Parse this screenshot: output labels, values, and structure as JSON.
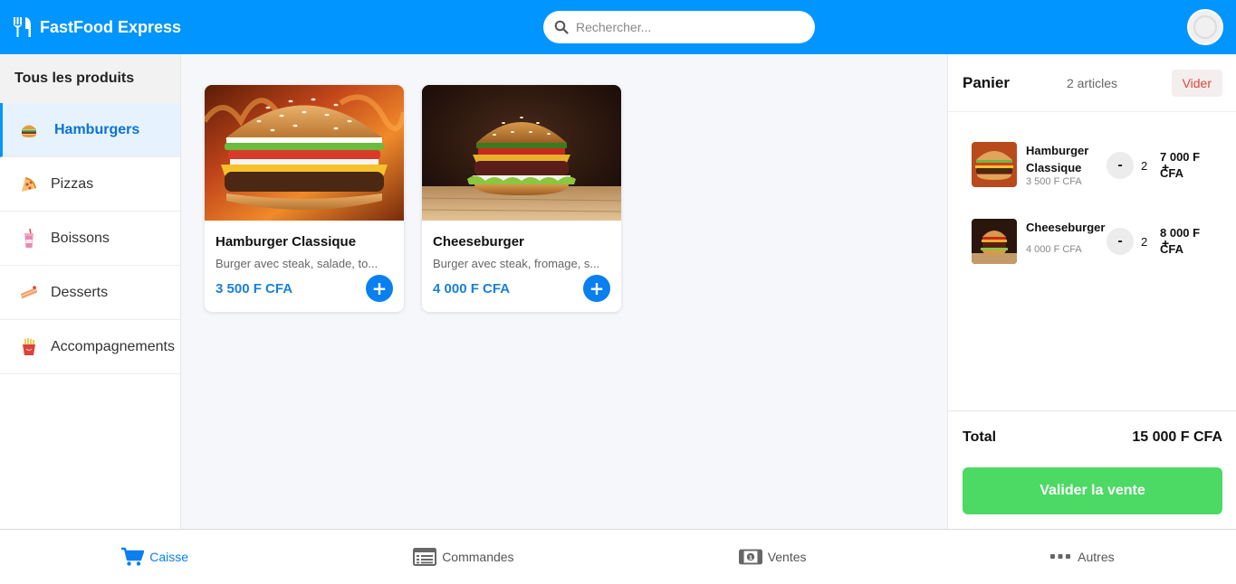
{
  "header": {
    "brand": "FastFood Express",
    "search_placeholder": "Rechercher..."
  },
  "sidebar": {
    "title": "Tous les produits",
    "items": [
      {
        "label": "Hamburgers",
        "icon": "burger-icon",
        "active": true
      },
      {
        "label": "Pizzas",
        "icon": "pizza-icon",
        "active": false
      },
      {
        "label": "Boissons",
        "icon": "drink-icon",
        "active": false
      },
      {
        "label": "Desserts",
        "icon": "cake-icon",
        "active": false
      },
      {
        "label": "Accompagnements",
        "icon": "fries-icon",
        "active": false
      }
    ]
  },
  "products": [
    {
      "name": "Hamburger Classique",
      "desc": "Burger avec steak, salade, to...",
      "price": "3 500 F CFA",
      "add": "+"
    },
    {
      "name": "Cheeseburger",
      "desc": "Burger avec steak, fromage, s...",
      "price": "4 000 F CFA",
      "add": "+"
    }
  ],
  "cart": {
    "title": "Panier",
    "count": "2 articles",
    "clear": "Vider",
    "items": [
      {
        "name": "Hamburger Classique",
        "unit": "3 500 F CFA",
        "minus": "-",
        "qty": "2",
        "total": "7 000 F CFA",
        "plus": "+"
      },
      {
        "name": "Cheeseburger",
        "unit": "4 000 F CFA",
        "minus": "-",
        "qty": "2",
        "total": "8 000 F CFA",
        "plus": "+"
      }
    ],
    "total_label": "Total",
    "total_value": "15 000 F CFA",
    "validate": "Valider la vente"
  },
  "bottom_nav": [
    {
      "label": "Caisse",
      "icon": "cart-icon",
      "active": true
    },
    {
      "label": "Commandes",
      "icon": "receipt-icon",
      "active": false
    },
    {
      "label": "Ventes",
      "icon": "banknote-icon",
      "active": false
    },
    {
      "label": "Autres",
      "icon": "more-icon",
      "active": false
    }
  ],
  "colors": {
    "primary": "#0095ff",
    "accent_blue": "#0a7ff0",
    "validate_green": "#4cd964",
    "danger": "#e0453a"
  }
}
